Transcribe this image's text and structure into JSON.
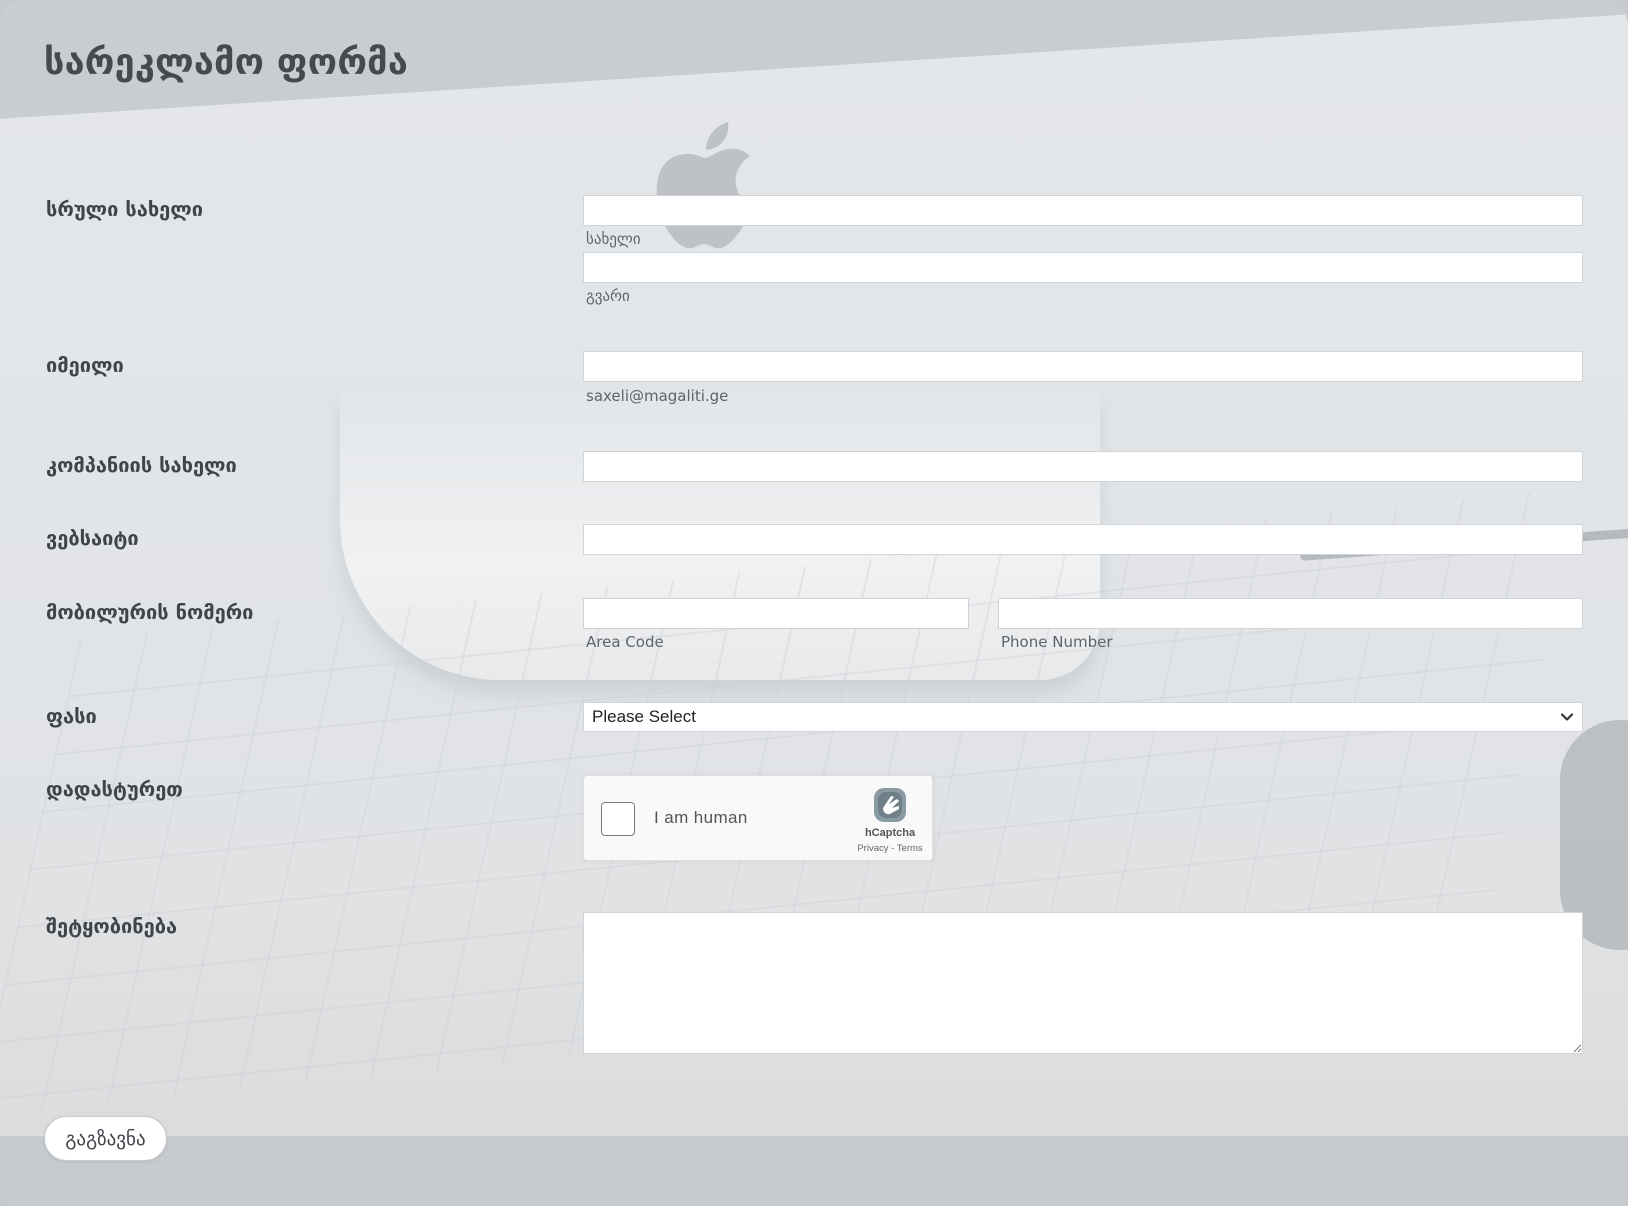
{
  "form": {
    "title": "სარეკლამო ფორმა"
  },
  "fields": {
    "full_name": {
      "label": "სრული სახელი",
      "first_value": "",
      "first_sublabel": "სახელი",
      "last_value": "",
      "last_sublabel": "გვარი"
    },
    "email": {
      "label": "იმეილი",
      "value": "",
      "sublabel": "saxeli@magaliti.ge"
    },
    "company": {
      "label": "კომპანიის სახელი",
      "value": ""
    },
    "website": {
      "label": "ვებსაიტი",
      "value": ""
    },
    "mobile": {
      "label": "მობილურის ნომერი",
      "area_value": "",
      "area_sublabel": "Area Code",
      "phone_value": "",
      "phone_sublabel": "Phone Number"
    },
    "price": {
      "label": "ფასი",
      "selected": "Please Select"
    },
    "verify": {
      "label": "დადასტურეთ",
      "captcha_text": "I am human",
      "captcha_brand": "hCaptcha",
      "captcha_privacy": "Privacy",
      "captcha_separator": " - ",
      "captcha_terms": "Terms"
    },
    "message": {
      "label": "შეტყობინება",
      "value": ""
    }
  },
  "actions": {
    "submit_label": "გაგზავნა"
  },
  "icons": {
    "background": "apple-logo-icon",
    "select": "chevron-down-icon",
    "captcha": "hcaptcha-logo-icon"
  }
}
